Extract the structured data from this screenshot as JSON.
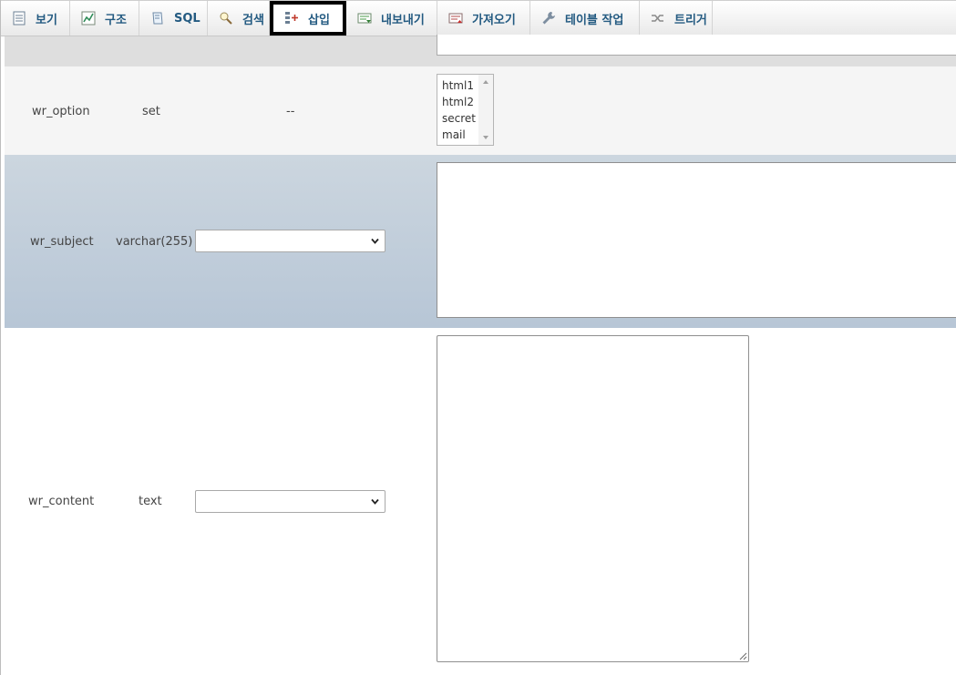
{
  "tabs": [
    {
      "label": "보기",
      "icon": "browse-icon"
    },
    {
      "label": "구조",
      "icon": "structure-icon"
    },
    {
      "label": "SQL",
      "icon": "sql-icon"
    },
    {
      "label": "검색",
      "icon": "search-icon"
    },
    {
      "label": "삽입",
      "icon": "insert-icon",
      "active": true
    },
    {
      "label": "내보내기",
      "icon": "export-icon"
    },
    {
      "label": "가져오기",
      "icon": "import-icon"
    },
    {
      "label": "테이블 작업",
      "icon": "wrench-icon"
    },
    {
      "label": "트리거",
      "icon": "trigger-icon"
    }
  ],
  "rows": {
    "option": {
      "column": "wr_option",
      "type": "set",
      "function": "--",
      "options": [
        "html1",
        "html2",
        "secret",
        "mail"
      ]
    },
    "subject": {
      "column": "wr_subject",
      "type": "varchar(255)",
      "function_value": "",
      "value": ""
    },
    "content": {
      "column": "wr_content",
      "type": "text",
      "function_value": "",
      "value": ""
    }
  },
  "colors": {
    "tab_text": "#235a81",
    "subject_row_top": "#ccd6df",
    "subject_row_bottom": "#b7c6d6",
    "active_tab_outline": "#000000"
  }
}
